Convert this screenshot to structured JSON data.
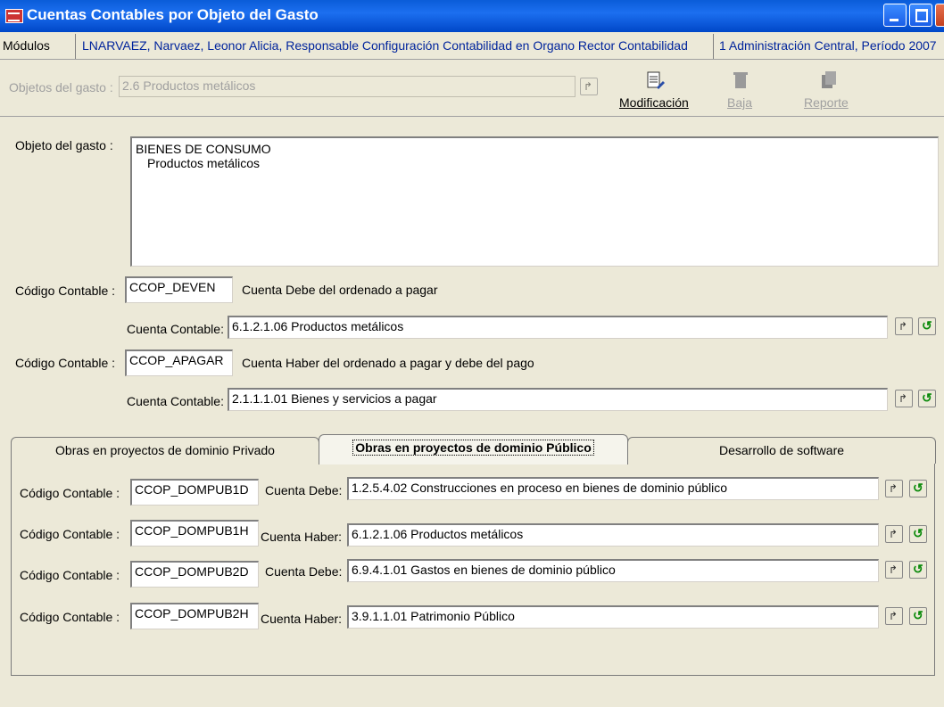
{
  "window": {
    "title": "Cuentas Contables por Objeto del Gasto"
  },
  "infobar": {
    "modules_label": "Módulos",
    "user": "LNARVAEZ, Narvaez, Leonor Alicia, Responsable Configuración Contabilidad en Organo Rector Contabilidad",
    "period": "1 Administración Central, Período 2007"
  },
  "toolbar": {
    "objeto_label": "Objetos del gasto :",
    "objeto_value": "2.6 Productos metálicos",
    "modificacion_label": "Modificación",
    "baja_label": "Baja",
    "reporte_label": "Reporte"
  },
  "form": {
    "objeto_gasto_label": "Objeto del gasto :",
    "objeto_gasto_line1": "BIENES DE CONSUMO",
    "objeto_gasto_line2": "Productos metálicos",
    "codigo1_label": "Código Contable :",
    "codigo1_value": "CCOP_DEVEN",
    "codigo1_desc": "Cuenta Debe del ordenado a pagar",
    "cuenta1_label": "Cuenta Contable:",
    "cuenta1_value": "6.1.2.1.06 Productos metálicos",
    "codigo2_label": "Código Contable :",
    "codigo2_value": "CCOP_APAGAR",
    "codigo2_desc": "Cuenta Haber del ordenado a pagar y debe del pago",
    "cuenta2_label": "Cuenta Contable:",
    "cuenta2_value": "2.1.1.1.01 Bienes y servicios a pagar"
  },
  "tabs": [
    {
      "label": "Obras en proyectos de dominio Privado"
    },
    {
      "label": "Obras en proyectos de dominio Público"
    },
    {
      "label": "Desarrollo de software"
    }
  ],
  "tab_rows": [
    {
      "label": "Código Contable :",
      "code": "CCOP_DOMPUB1D",
      "cuenta_label": "Cuenta Debe:",
      "cuenta_value": "1.2.5.4.02 Construcciones en proceso en bienes de dominio público"
    },
    {
      "label": "Código Contable :",
      "code": "CCOP_DOMPUB1H",
      "cuenta_label": "Cuenta Haber:",
      "cuenta_value": "6.1.2.1.06 Productos metálicos"
    },
    {
      "label": "Código Contable :",
      "code": "CCOP_DOMPUB2D",
      "cuenta_label": "Cuenta Debe:",
      "cuenta_value": "6.9.4.1.01 Gastos en bienes de dominio público"
    },
    {
      "label": "Código Contable :",
      "code": "CCOP_DOMPUB2H",
      "cuenta_label": "Cuenta Haber:",
      "cuenta_value": "3.9.1.1.01 Patrimonio Público"
    }
  ]
}
